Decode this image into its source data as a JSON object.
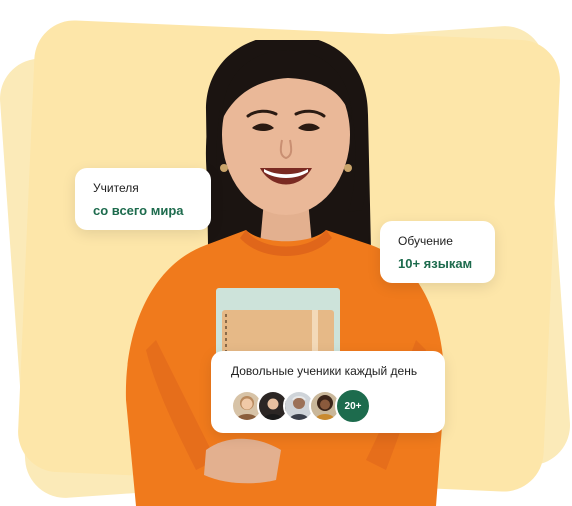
{
  "cards": {
    "teachers": {
      "label": "Учителя",
      "value": "со всего мира"
    },
    "learning": {
      "label": "Обучение",
      "value": "10+ языкам"
    },
    "students": {
      "label": "Довольные ученики каждый день",
      "count_badge": "20+",
      "avatars": [
        "avatar-woman-older",
        "avatar-woman-dark-hair",
        "avatar-man-older",
        "avatar-woman-curly"
      ]
    }
  },
  "colors": {
    "background_shape": "#fde6a9",
    "accent_green": "#1d6b4d",
    "sweater_orange": "#f07a1c"
  }
}
